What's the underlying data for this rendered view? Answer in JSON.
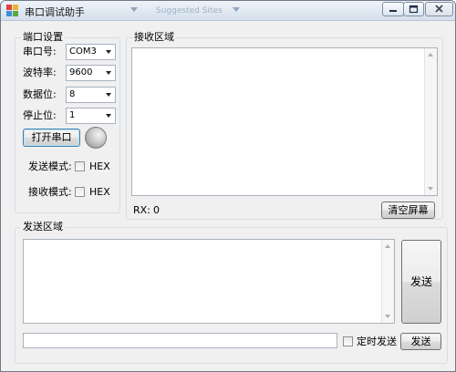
{
  "window": {
    "title": "串口调试助手",
    "ghost_tabs": [
      "Suggested Sites"
    ]
  },
  "port_settings": {
    "group_title": "端口设置",
    "port_label": "串口号:",
    "port_value": "COM3",
    "baud_label": "波特率:",
    "baud_value": "9600",
    "databits_label": "数据位:",
    "databits_value": "8",
    "stopbits_label": "停止位:",
    "stopbits_value": "1",
    "open_button": "打开串口",
    "send_mode_label": "发送模式:",
    "send_mode_hex": "HEX",
    "recv_mode_label": "接收模式:",
    "recv_mode_hex": "HEX"
  },
  "receive": {
    "group_title": "接收区域",
    "rx_label": "RX:",
    "rx_count": "0",
    "clear_button": "清空屏幕"
  },
  "send": {
    "group_title": "发送区域",
    "send_button": "发送",
    "auto_send_label": "定时发送",
    "send_button_small": "发送"
  }
}
